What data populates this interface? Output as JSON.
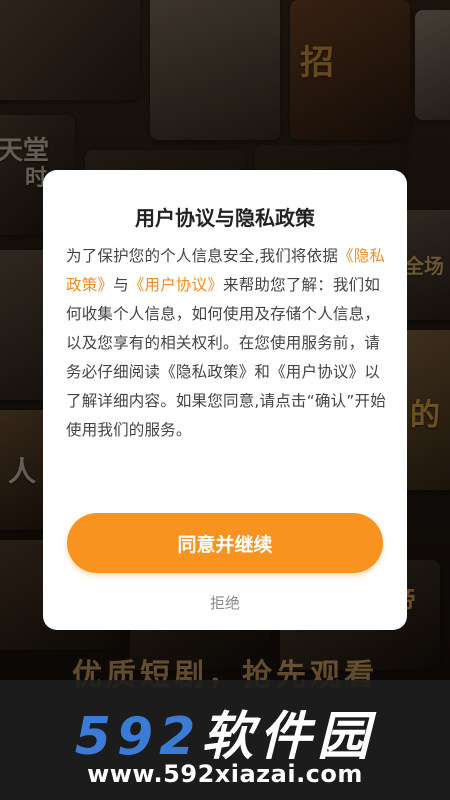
{
  "background": {
    "poster_texts": [
      "招",
      "天堂",
      "时",
      "全场",
      "的",
      "人",
      "帝"
    ],
    "slogan": "优质短剧，抢先观看"
  },
  "dialog": {
    "title": "用户协议与隐私政策",
    "body_intro": "为了保护您的个人信息安全,我们将依据",
    "privacy_link": "《隐私政策》",
    "and_word": "与",
    "user_agreement_link": "《用户协议》",
    "body_rest": "来帮助您了解：我们如何收集个人信息，如何使用及存储个人信息，以及您享有的相关权利。在您使用服务前，请务必仔细阅读《隐私政策》和《用户协议》以了解详细内容。如果您同意,请点击“确认”开始使用我们的服务。",
    "agree_button": "同意并继续",
    "reject_button": "拒绝"
  },
  "watermark": {
    "logo_number": "592",
    "logo_text": "软件园",
    "url": "www.592xiazai.com"
  },
  "colors": {
    "accent": "#f7931e",
    "link": "#f48b1f",
    "watermark_blue": "#3a7bd5"
  }
}
